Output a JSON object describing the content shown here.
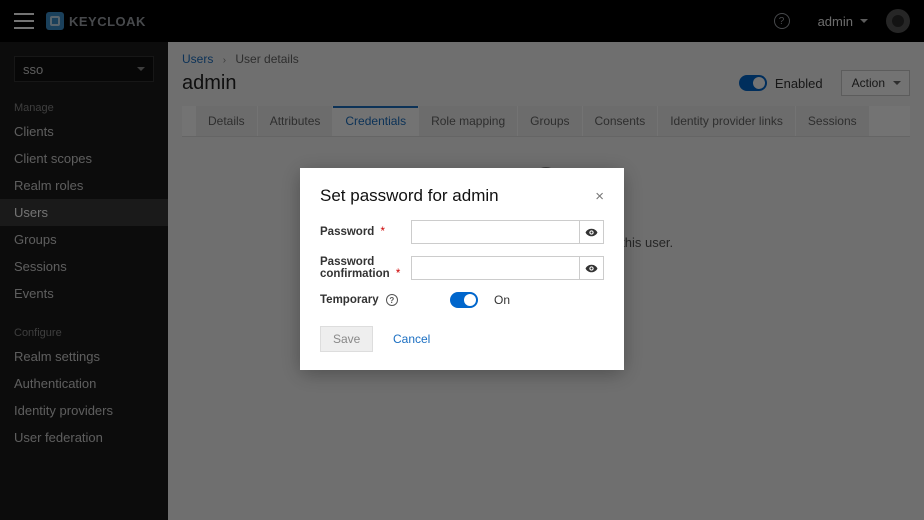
{
  "topbar": {
    "product": "KEYCLOAK",
    "help_glyph": "?",
    "user_menu_label": "admin"
  },
  "sidebar": {
    "realm": "sso",
    "section_manage": "Manage",
    "manage_items": [
      "Clients",
      "Client scopes",
      "Realm roles",
      "Users",
      "Groups",
      "Sessions",
      "Events"
    ],
    "active_manage_index": 3,
    "section_configure": "Configure",
    "configure_items": [
      "Realm settings",
      "Authentication",
      "Identity providers",
      "User federation"
    ]
  },
  "breadcrumbs": {
    "link": "Users",
    "sep_glyph": "›",
    "current": "User details"
  },
  "page": {
    "title": "admin",
    "enabled_label": "Enabled",
    "action_btn_label": "Action"
  },
  "tabs": {
    "items": [
      "Details",
      "Attributes",
      "Credentials",
      "Role mapping",
      "Groups",
      "Consents",
      "Identity provider links",
      "Sessions"
    ],
    "active_index": 2
  },
  "tab_content": {
    "plus_glyph": "+",
    "no_credentials_text": "No credentials. Set a password for this user."
  },
  "modal": {
    "title": "Set password for admin",
    "close_glyph": "×",
    "password_label": "Password",
    "password_confirm_label": "Password confirmation",
    "required_mark": "*",
    "temporary_label": "Temporary",
    "temporary_value_label": "On",
    "help_glyph": "?",
    "save_label": "Save",
    "cancel_label": "Cancel"
  }
}
